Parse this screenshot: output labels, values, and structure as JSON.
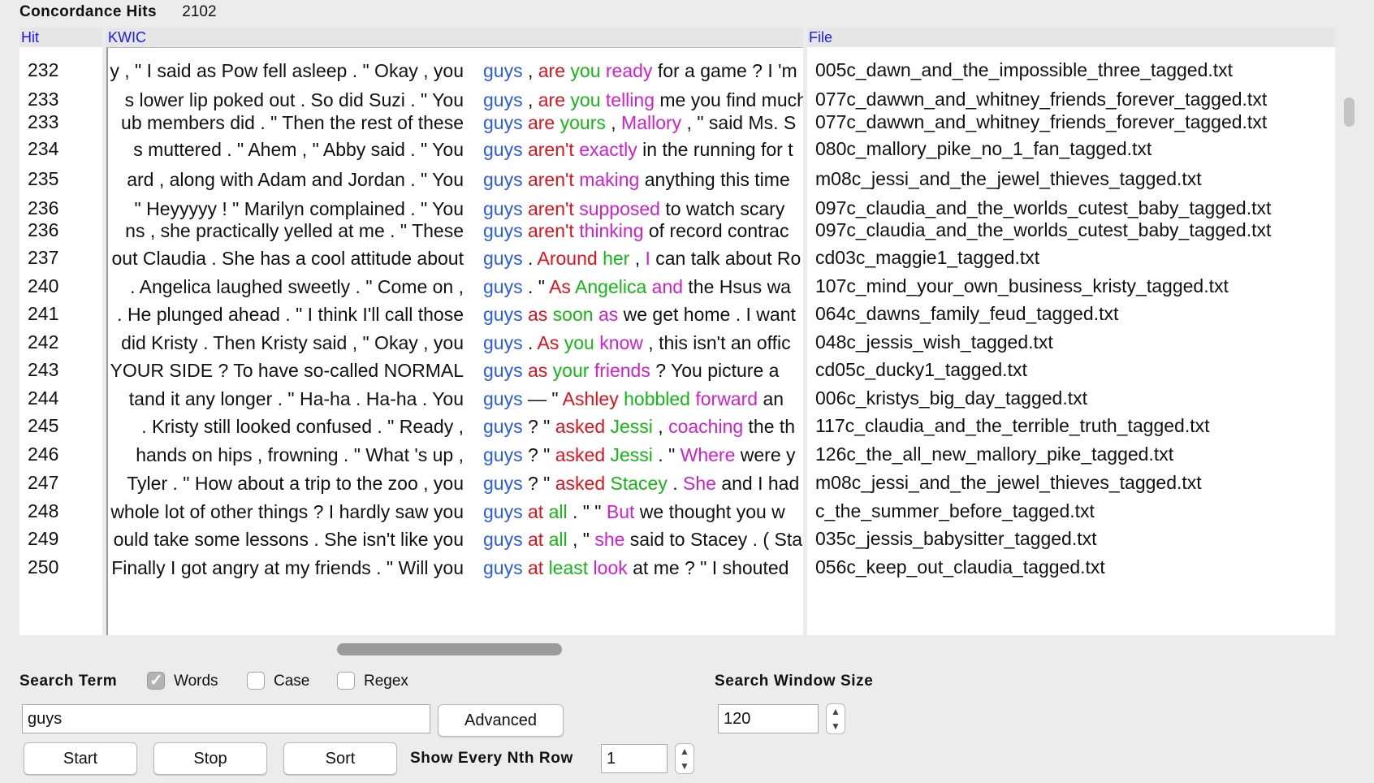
{
  "header": {
    "title": "Concordance Hits",
    "count": "2102"
  },
  "columns": {
    "hit": "Hit",
    "kwic": "KWIC",
    "file": "File"
  },
  "colors": {
    "keyword": "#2a5bea",
    "red": "#e0121c",
    "green": "#14b814",
    "magenta": "#d01fd0",
    "column_header": "#1a1af0"
  },
  "rows": [
    {
      "hit": "232",
      "left": "y , \" I said as Pow fell asleep . \" Okay , you",
      "right": [
        [
          "guys",
          "kw"
        ],
        [
          " , ",
          ""
        ],
        [
          "are",
          "c1"
        ],
        [
          " ",
          ""
        ],
        [
          "you",
          "c2"
        ],
        [
          " ",
          ""
        ],
        [
          "ready",
          "c3"
        ],
        [
          " for a game ? I 'm",
          ""
        ]
      ],
      "file": "005c_dawn_and_the_impossible_three_tagged.txt"
    },
    {
      "hit": "233",
      "left": "s lower lip poked out . So did Suzi .   \" You",
      "right": [
        [
          "guys",
          "kw"
        ],
        [
          " , ",
          ""
        ],
        [
          "are",
          "c1"
        ],
        [
          " ",
          ""
        ],
        [
          "you",
          "c2"
        ],
        [
          " ",
          ""
        ],
        [
          "telling",
          "c3"
        ],
        [
          " me you find much",
          ""
        ]
      ],
      "file": "077c_dawwn_and_whitney_friends_forever_tagged.txt"
    },
    {
      "hit": "233",
      "left": "ub members did . \" Then the rest of these",
      "right": [
        [
          "guys",
          "kw"
        ],
        [
          " ",
          ""
        ],
        [
          "are",
          "c1"
        ],
        [
          " ",
          ""
        ],
        [
          "yours",
          "c2"
        ],
        [
          " , ",
          ""
        ],
        [
          "Mallory",
          "c3"
        ],
        [
          " , \" said Ms. S",
          ""
        ]
      ],
      "file": "077c_dawwn_and_whitney_friends_forever_tagged.txt"
    },
    {
      "hit": "234",
      "left": "s muttered .   \" Ahem , \" Abby said . \" You",
      "right": [
        [
          "guys",
          "kw"
        ],
        [
          " ",
          ""
        ],
        [
          "aren't",
          "c1"
        ],
        [
          " ",
          ""
        ],
        [
          "exactly",
          "c3"
        ],
        [
          " in the running for t",
          ""
        ]
      ],
      "file": "080c_mallory_pike_no_1_fan_tagged.txt"
    },
    {
      "hit": "235",
      "left": "ard , along with Adam and Jordan .   \" You",
      "right": [
        [
          "guys",
          "kw"
        ],
        [
          " ",
          ""
        ],
        [
          "aren't",
          "c1"
        ],
        [
          " ",
          ""
        ],
        [
          "making",
          "c3"
        ],
        [
          " anything this time",
          ""
        ]
      ],
      "file": "m08c_jessi_and_the_jewel_thieves_tagged.txt"
    },
    {
      "hit": "236",
      "left": "\" Heyyyyy ! \" Marilyn complained .   \" You",
      "right": [
        [
          "guys",
          "kw"
        ],
        [
          " ",
          ""
        ],
        [
          "aren't",
          "c1"
        ],
        [
          " ",
          ""
        ],
        [
          "supposed",
          "c3"
        ],
        [
          " to watch scary",
          ""
        ]
      ],
      "file": "097c_claudia_and_the_worlds_cutest_baby_tagged.txt"
    },
    {
      "hit": "236",
      "left": "ns , she practically yelled at me .   \" These",
      "right": [
        [
          "guys",
          "kw"
        ],
        [
          " ",
          ""
        ],
        [
          "aren't",
          "c1"
        ],
        [
          " ",
          ""
        ],
        [
          "thinking",
          "c3"
        ],
        [
          " of record contrac",
          ""
        ]
      ],
      "file": "097c_claudia_and_the_worlds_cutest_baby_tagged.txt"
    },
    {
      "hit": "237",
      "left": "out Claudia . She has a cool attitude about",
      "right": [
        [
          "guys",
          "kw"
        ],
        [
          " . ",
          ""
        ],
        [
          "Around",
          "c1"
        ],
        [
          " ",
          ""
        ],
        [
          "her",
          "c2"
        ],
        [
          " , ",
          ""
        ],
        [
          "I",
          "c3"
        ],
        [
          " can talk about Ro",
          ""
        ]
      ],
      "file": "cd03c_maggie1_tagged.txt"
    },
    {
      "hit": "240",
      "left": ".   Angelica laughed sweetly . \" Come on ,",
      "right": [
        [
          "guys",
          "kw"
        ],
        [
          " . \"   ",
          ""
        ],
        [
          "As",
          "c1"
        ],
        [
          " ",
          ""
        ],
        [
          "Angelica",
          "c2"
        ],
        [
          " ",
          ""
        ],
        [
          "and",
          "c3"
        ],
        [
          " the Hsus wa",
          ""
        ]
      ],
      "file": "107c_mind_your_own_business_kristy_tagged.txt"
    },
    {
      "hit": "241",
      "left": ". He plunged ahead . \" I think I'll call those",
      "right": [
        [
          "guys",
          "kw"
        ],
        [
          " ",
          ""
        ],
        [
          "as",
          "c1"
        ],
        [
          " ",
          ""
        ],
        [
          "soon",
          "c2"
        ],
        [
          " ",
          ""
        ],
        [
          "as",
          "c3"
        ],
        [
          " we get home . I want",
          ""
        ]
      ],
      "file": "064c_dawns_family_feud_tagged.txt"
    },
    {
      "hit": "242",
      "left": "did Kristy .   Then Kristy said , \" Okay , you",
      "right": [
        [
          "guys",
          "kw"
        ],
        [
          " . ",
          ""
        ],
        [
          "As",
          "c1"
        ],
        [
          " ",
          ""
        ],
        [
          "you",
          "c2"
        ],
        [
          " ",
          ""
        ],
        [
          "know",
          "c3"
        ],
        [
          " , this isn't an offic",
          ""
        ]
      ],
      "file": "048c_jessis_wish_tagged.txt"
    },
    {
      "hit": "243",
      "left": "YOUR SIDE ? To have so-called NORMAL",
      "right": [
        [
          "guys",
          "kw"
        ],
        [
          " ",
          ""
        ],
        [
          "as",
          "c1"
        ],
        [
          " ",
          ""
        ],
        [
          "your",
          "c2"
        ],
        [
          " ",
          ""
        ],
        [
          "friends",
          "c3"
        ],
        [
          " ?   You picture a",
          ""
        ]
      ],
      "file": "cd05c_ducky1_tagged.txt"
    },
    {
      "hit": "244",
      "left": "tand it any longer .   \" Ha-ha . Ha-ha . You",
      "right": [
        [
          "guys",
          "kw"
        ],
        [
          " — \"   ",
          ""
        ],
        [
          "Ashley",
          "c1"
        ],
        [
          " ",
          ""
        ],
        [
          "hobbled",
          "c2"
        ],
        [
          " ",
          ""
        ],
        [
          "forward",
          "c3"
        ],
        [
          " an",
          ""
        ]
      ],
      "file": "006c_kristys_big_day_tagged.txt"
    },
    {
      "hit": "245",
      "left": ".   Kristy still looked confused .   \" Ready ,",
      "right": [
        [
          "guys",
          "kw"
        ],
        [
          " ? \" ",
          ""
        ],
        [
          "asked",
          "c1"
        ],
        [
          " ",
          ""
        ],
        [
          "Jessi",
          "c2"
        ],
        [
          " , ",
          ""
        ],
        [
          "coaching",
          "c3"
        ],
        [
          " the th",
          ""
        ]
      ],
      "file": "117c_claudia_and_the_terrible_truth_tagged.txt"
    },
    {
      "hit": "246",
      "left": "hands on hips , frowning .   \" What 's up ,",
      "right": [
        [
          "guys",
          "kw"
        ],
        [
          " ? \" ",
          ""
        ],
        [
          "asked",
          "c1"
        ],
        [
          " ",
          ""
        ],
        [
          "Jessi",
          "c2"
        ],
        [
          " .   \" ",
          ""
        ],
        [
          "Where",
          "c3"
        ],
        [
          " were y",
          ""
        ]
      ],
      "file": "126c_the_all_new_mallory_pike_tagged.txt"
    },
    {
      "hit": "247",
      "left": "Tyler . \" How about a trip to the zoo , you",
      "right": [
        [
          "guys",
          "kw"
        ],
        [
          " ? \" ",
          ""
        ],
        [
          "asked",
          "c1"
        ],
        [
          " ",
          ""
        ],
        [
          "Stacey",
          "c2"
        ],
        [
          " . ",
          ""
        ],
        [
          "She",
          "c3"
        ],
        [
          " and I had",
          ""
        ]
      ],
      "file": "m08c_jessi_and_the_jewel_thieves_tagged.txt"
    },
    {
      "hit": "248",
      "left": "whole lot of other things ? I hardly saw you",
      "right": [
        [
          "guys",
          "kw"
        ],
        [
          " ",
          ""
        ],
        [
          "at",
          "c1"
        ],
        [
          " ",
          ""
        ],
        [
          "all",
          "c2"
        ],
        [
          " . \"   \" ",
          ""
        ],
        [
          "But",
          "c3"
        ],
        [
          " we thought you w",
          ""
        ]
      ],
      "file": "c_the_summer_before_tagged.txt"
    },
    {
      "hit": "249",
      "left": "ould take some lessons . She isn't like you",
      "right": [
        [
          "guys",
          "kw"
        ],
        [
          " ",
          ""
        ],
        [
          "at",
          "c1"
        ],
        [
          " ",
          ""
        ],
        [
          "all",
          "c2"
        ],
        [
          " , \" ",
          ""
        ],
        [
          "she",
          "c3"
        ],
        [
          " said to Stacey . ( Sta",
          ""
        ]
      ],
      "file": "035c_jessis_babysitter_tagged.txt"
    },
    {
      "hit": "250",
      "left": "Finally I got angry at my friends . \" Will you",
      "right": [
        [
          "guys",
          "kw"
        ],
        [
          " ",
          ""
        ],
        [
          "at",
          "c1"
        ],
        [
          " ",
          ""
        ],
        [
          "least",
          "c2"
        ],
        [
          " ",
          ""
        ],
        [
          "look",
          "c3"
        ],
        [
          " at me ? \" I shouted",
          ""
        ]
      ],
      "file": "056c_keep_out_claudia_tagged.txt"
    }
  ],
  "controls": {
    "search_term_label": "Search Term",
    "words_label": "Words",
    "words_checked": true,
    "case_label": "Case",
    "case_checked": false,
    "regex_label": "Regex",
    "regex_checked": false,
    "search_value": "guys",
    "advanced_label": "Advanced",
    "window_size_label": "Search Window Size",
    "window_size_value": "120",
    "start_label": "Start",
    "stop_label": "Stop",
    "sort_label": "Sort",
    "nth_row_label": "Show Every Nth Row",
    "nth_row_value": "1"
  }
}
